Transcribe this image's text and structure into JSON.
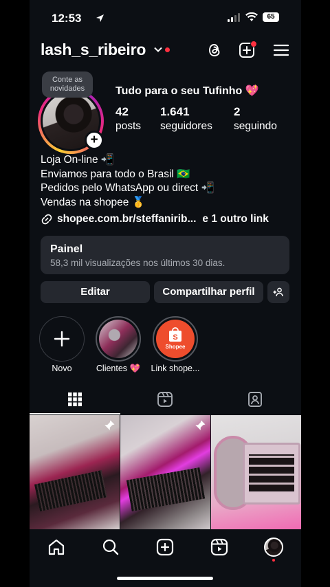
{
  "status_bar": {
    "time": "12:53",
    "battery": "65"
  },
  "header": {
    "username": "lash_s_ribeiro"
  },
  "profile": {
    "note_bubble": "Conte as novidades",
    "display_name": "Tudo para o seu Tufinho 💖",
    "stats": [
      {
        "value": "42",
        "label": "posts"
      },
      {
        "value": "1.641",
        "label": "seguidores"
      },
      {
        "value": "2",
        "label": "seguindo"
      }
    ],
    "bio_lines": [
      "Loja On-line 📲",
      "Enviamos para todo o Brasil 🇧🇷",
      "Pedidos pelo WhatsApp ou direct 📲",
      "Vendas na shopee 🥇"
    ],
    "link_text": "shopee.com.br/steffaniri​b...",
    "link_more": "e 1 outro link"
  },
  "dashboard": {
    "title": "Painel",
    "subtitle": "58,3 mil visualizações nos últimos 30 dias."
  },
  "actions": {
    "edit": "Editar",
    "share": "Compartilhar perfil"
  },
  "highlights": [
    {
      "label": "Novo"
    },
    {
      "label": "Clientes 💖"
    },
    {
      "label": "Link shope..."
    }
  ],
  "shopee_logo_text": "Shopee",
  "colors": {
    "background": "#0c0f14",
    "card": "#25282f",
    "accent": "#ff3040",
    "shopee": "#ee4d2d"
  }
}
